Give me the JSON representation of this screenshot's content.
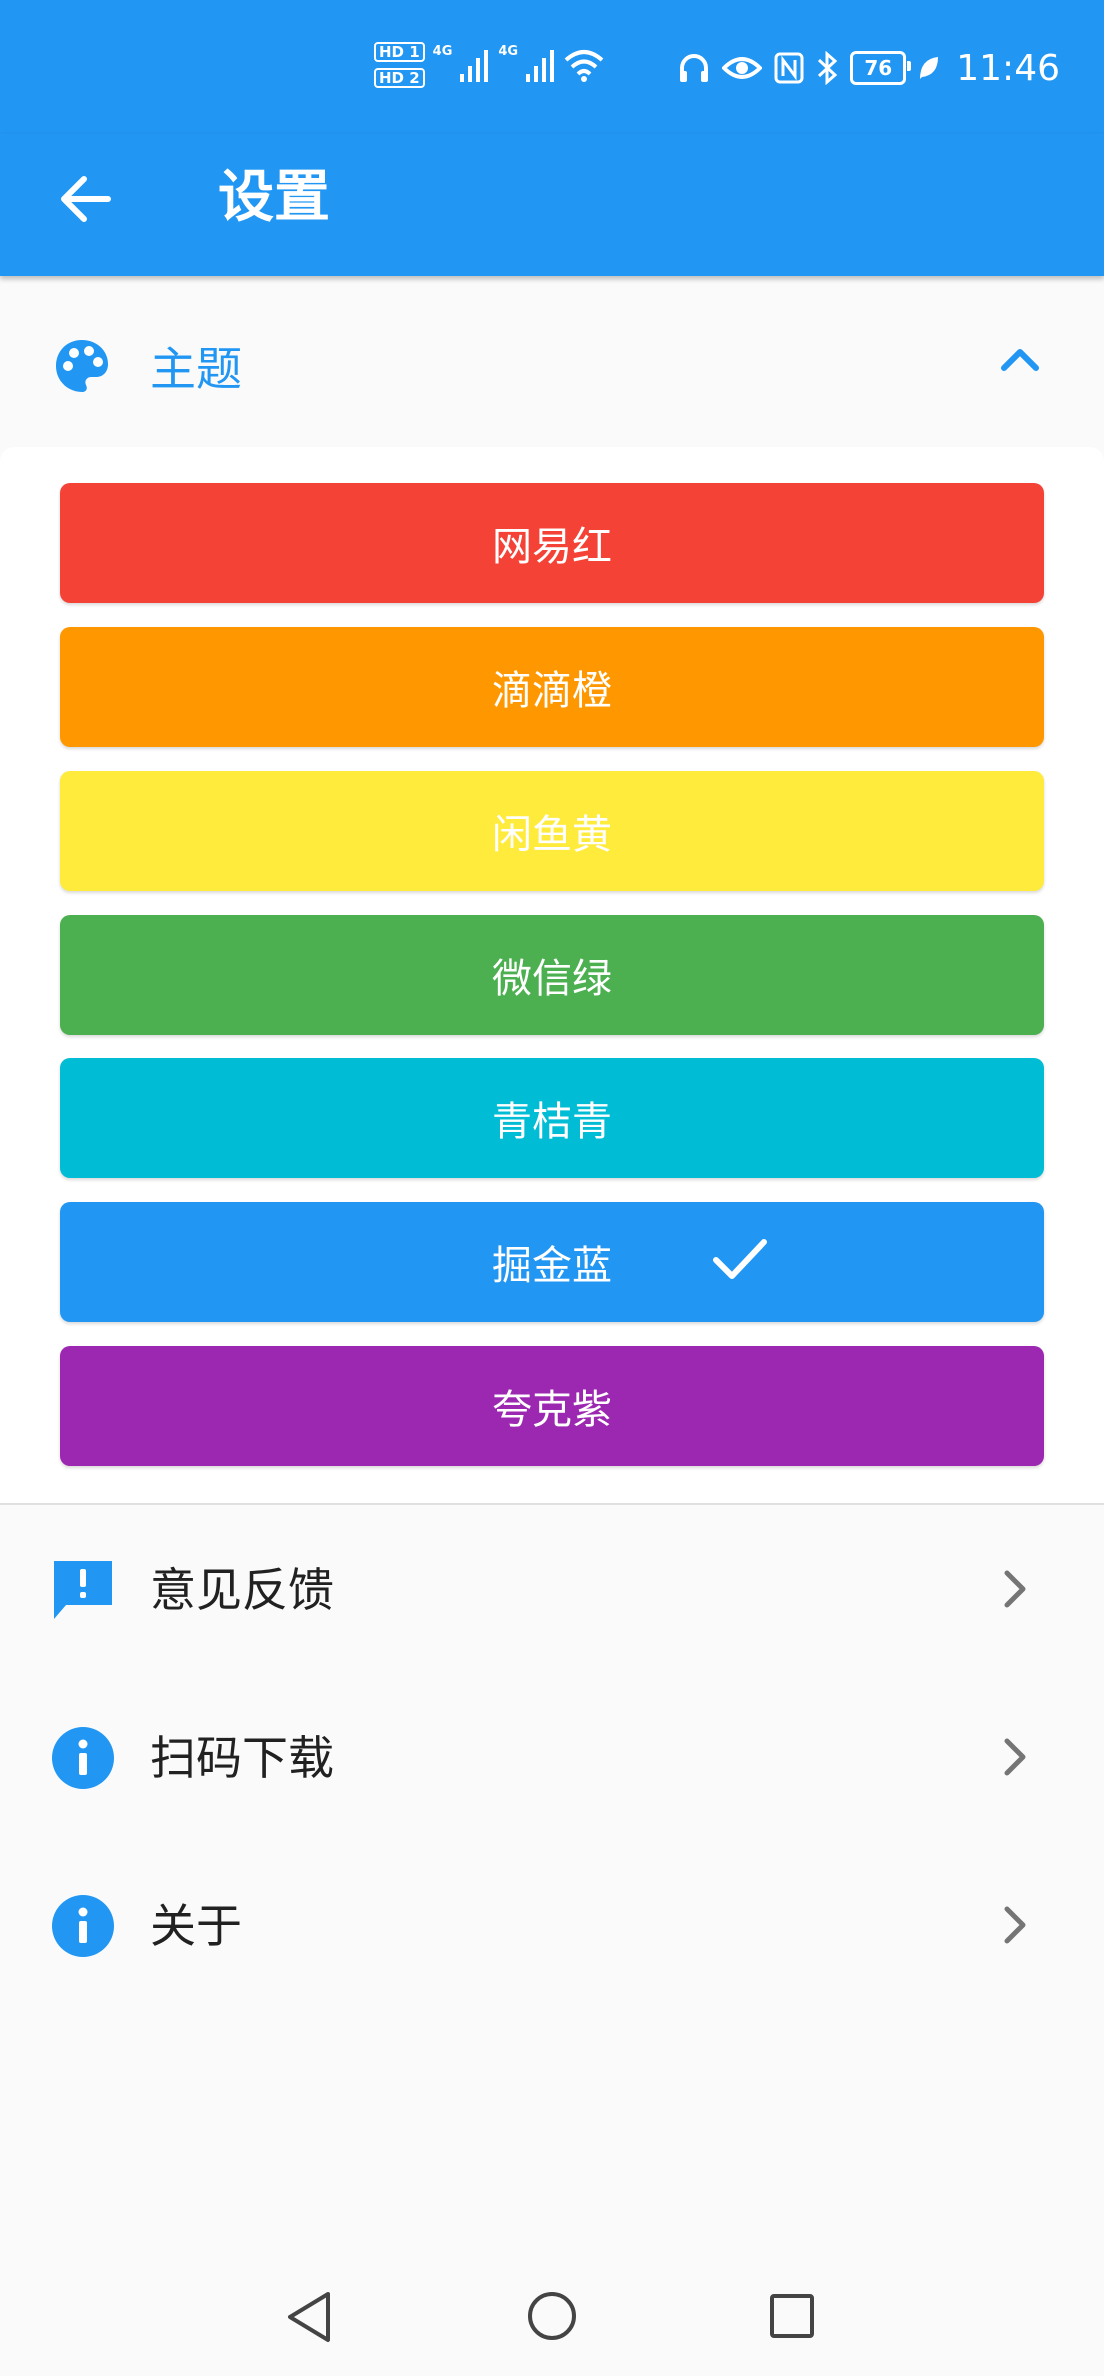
{
  "statusbar": {
    "sim1": "HD 1",
    "sim2": "HD 2",
    "net1": "4G",
    "net2": "4G",
    "battery": "76",
    "time": "11:46"
  },
  "appbar": {
    "title": "设置",
    "back_icon": "arrow-back-icon"
  },
  "theme_section": {
    "label": "主题",
    "icon": "palette-icon",
    "expanded": true,
    "options": [
      {
        "label": "网易红",
        "color": "#f44336",
        "selected": false
      },
      {
        "label": "滴滴橙",
        "color": "#ff9800",
        "selected": false
      },
      {
        "label": "闲鱼黄",
        "color": "#ffeb3b",
        "selected": false
      },
      {
        "label": "微信绿",
        "color": "#4caf50",
        "selected": false
      },
      {
        "label": "青桔青",
        "color": "#00bcd4",
        "selected": false
      },
      {
        "label": "掘金蓝",
        "color": "#2196f3",
        "selected": true
      },
      {
        "label": "夸克紫",
        "color": "#9c27b0",
        "selected": false
      }
    ]
  },
  "menu": [
    {
      "label": "意见反馈",
      "icon": "feedback-icon"
    },
    {
      "label": "扫码下载",
      "icon": "info-icon"
    },
    {
      "label": "关于",
      "icon": "info-icon"
    }
  ],
  "colors": {
    "primary": "#2196f3",
    "background": "#fafafa"
  }
}
